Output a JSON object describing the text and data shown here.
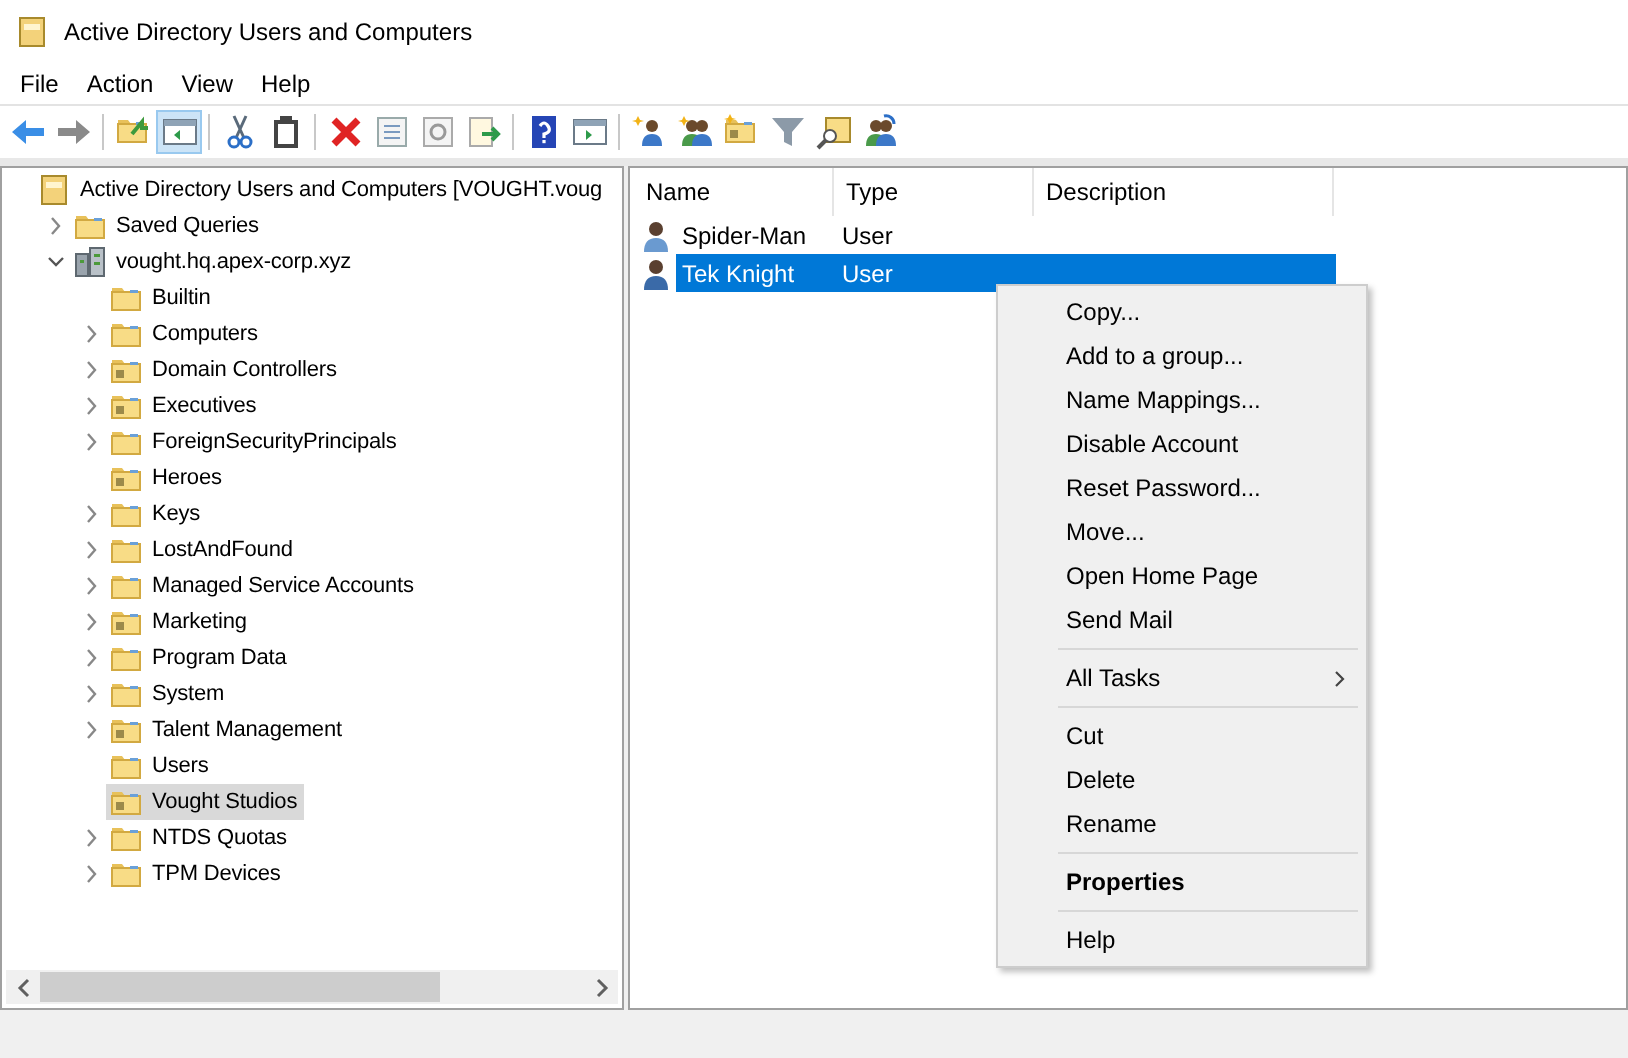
{
  "window": {
    "title": "Active Directory Users and Computers"
  },
  "menu": [
    "File",
    "Action",
    "View",
    "Help"
  ],
  "toolbar": [
    [
      {
        "kind": "back",
        "pressed": false
      },
      {
        "kind": "forward",
        "pressed": false
      }
    ],
    [
      {
        "kind": "up",
        "pressed": false
      },
      {
        "kind": "console-tree",
        "pressed": true
      }
    ],
    [
      {
        "kind": "cut",
        "pressed": false
      },
      {
        "kind": "paste",
        "pressed": false
      }
    ],
    [
      {
        "kind": "delete",
        "pressed": false
      },
      {
        "kind": "properties",
        "pressed": false
      },
      {
        "kind": "refresh",
        "pressed": false
      },
      {
        "kind": "export",
        "pressed": false
      }
    ],
    [
      {
        "kind": "help",
        "pressed": false
      },
      {
        "kind": "action-pane",
        "pressed": false
      }
    ],
    [
      {
        "kind": "new-user",
        "pressed": false
      },
      {
        "kind": "new-group",
        "pressed": false
      },
      {
        "kind": "new-ou",
        "pressed": false
      },
      {
        "kind": "filter",
        "pressed": false
      },
      {
        "kind": "find",
        "pressed": false
      },
      {
        "kind": "add-to-group",
        "pressed": false
      }
    ]
  ],
  "tree": [
    {
      "label": "Active Directory Users and Computers [VOUGHT.voug",
      "kind": "root",
      "selected": false,
      "children": [
        {
          "label": "Saved Queries",
          "kind": "folder",
          "selected": false,
          "expanded": false
        },
        {
          "label": "vought.hq.apex-corp.xyz",
          "kind": "domain",
          "selected": false,
          "expanded": true,
          "children": [
            {
              "label": "Builtin",
              "kind": "folder",
              "selected": false
            },
            {
              "label": "Computers",
              "kind": "folder",
              "selected": false,
              "expanded": false
            },
            {
              "label": "Domain Controllers",
              "kind": "ou",
              "selected": false,
              "expanded": false
            },
            {
              "label": "Executives",
              "kind": "ou",
              "selected": false,
              "expanded": false
            },
            {
              "label": "ForeignSecurityPrincipals",
              "kind": "folder",
              "selected": false,
              "expanded": false
            },
            {
              "label": "Heroes",
              "kind": "ou",
              "selected": false
            },
            {
              "label": "Keys",
              "kind": "folder",
              "selected": false,
              "expanded": false
            },
            {
              "label": "LostAndFound",
              "kind": "folder",
              "selected": false,
              "expanded": false
            },
            {
              "label": "Managed Service Accounts",
              "kind": "folder",
              "selected": false,
              "expanded": false
            },
            {
              "label": "Marketing",
              "kind": "ou",
              "selected": false,
              "expanded": false
            },
            {
              "label": "Program Data",
              "kind": "folder",
              "selected": false,
              "expanded": false
            },
            {
              "label": "System",
              "kind": "folder",
              "selected": false,
              "expanded": false
            },
            {
              "label": "Talent Management",
              "kind": "ou",
              "selected": false,
              "expanded": false
            },
            {
              "label": "Users",
              "kind": "folder",
              "selected": false
            },
            {
              "label": "Vought Studios",
              "kind": "ou",
              "selected": true
            },
            {
              "label": "NTDS Quotas",
              "kind": "folder",
              "selected": false,
              "expanded": false
            },
            {
              "label": "TPM Devices",
              "kind": "folder",
              "selected": false,
              "expanded": false
            }
          ]
        }
      ]
    }
  ],
  "table": {
    "columns": [
      "Name",
      "Type",
      "Description"
    ],
    "rows": [
      {
        "name": "Spider-Man",
        "type": "User",
        "selected": false
      },
      {
        "name": "Tek Knight",
        "type": "User",
        "selected": true
      }
    ]
  },
  "context_menu": [
    {
      "kind": "item",
      "label": "Copy..."
    },
    {
      "kind": "item",
      "label": "Add to a group..."
    },
    {
      "kind": "item",
      "label": "Name Mappings..."
    },
    {
      "kind": "item",
      "label": "Disable Account"
    },
    {
      "kind": "item",
      "label": "Reset Password..."
    },
    {
      "kind": "item",
      "label": "Move..."
    },
    {
      "kind": "item",
      "label": "Open Home Page"
    },
    {
      "kind": "item",
      "label": "Send Mail"
    },
    {
      "kind": "separator"
    },
    {
      "kind": "submenu",
      "label": "All Tasks"
    },
    {
      "kind": "separator"
    },
    {
      "kind": "item",
      "label": "Cut"
    },
    {
      "kind": "item",
      "label": "Delete"
    },
    {
      "kind": "item",
      "label": "Rename"
    },
    {
      "kind": "separator"
    },
    {
      "kind": "default",
      "label": "Properties"
    },
    {
      "kind": "separator"
    },
    {
      "kind": "item",
      "label": "Help"
    }
  ]
}
